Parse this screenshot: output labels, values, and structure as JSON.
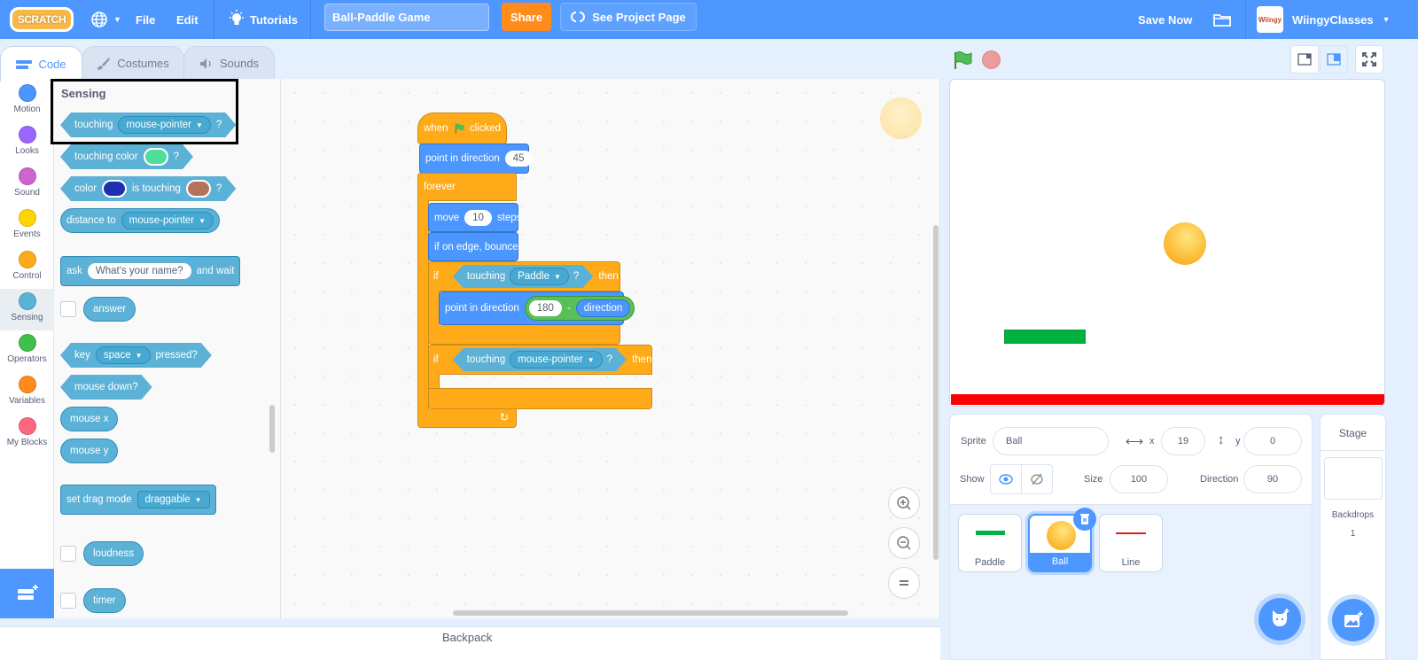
{
  "menubar": {
    "logo": "SCRATCH",
    "language_icon": "globe-icon",
    "file": "File",
    "edit": "Edit",
    "tutorials": "Tutorials",
    "project_title": "Ball-Paddle Game",
    "share": "Share",
    "see_project_page": "See Project Page",
    "save_now": "Save Now",
    "username": "WiingyClasses",
    "avatar_text": "Wiingy"
  },
  "tabs": [
    {
      "label": "Code",
      "icon": "code-icon",
      "active": true
    },
    {
      "label": "Costumes",
      "icon": "brush-icon",
      "active": false
    },
    {
      "label": "Sounds",
      "icon": "speaker-icon",
      "active": false
    }
  ],
  "categories": [
    {
      "label": "Motion",
      "color": "#4c97ff"
    },
    {
      "label": "Looks",
      "color": "#9966ff"
    },
    {
      "label": "Sound",
      "color": "#cf63cf"
    },
    {
      "label": "Events",
      "color": "#ffd500"
    },
    {
      "label": "Control",
      "color": "#ffab19"
    },
    {
      "label": "Sensing",
      "color": "#5cb1d6",
      "selected": true
    },
    {
      "label": "Operators",
      "color": "#40bf4a"
    },
    {
      "label": "Variables",
      "color": "#ff8c1a"
    },
    {
      "label": "My Blocks",
      "color": "#ff6680"
    }
  ],
  "palette": {
    "title": "Sensing",
    "touching": {
      "text": "touching",
      "menu": "mouse-pointer",
      "q": "?"
    },
    "touching_color": {
      "text": "touching color",
      "q": "?",
      "color": "#4cde9a"
    },
    "color_touching": {
      "text1": "color",
      "text2": "is touching",
      "q": "?",
      "color1": "#1f2fb0",
      "color2": "#b5715a"
    },
    "distance_to": {
      "text": "distance to",
      "menu": "mouse-pointer"
    },
    "ask": {
      "text1": "ask",
      "input": "What's your name?",
      "text2": "and wait"
    },
    "answer": "answer",
    "key_pressed": {
      "text1": "key",
      "menu": "space",
      "text2": "pressed?"
    },
    "mouse_down": "mouse down?",
    "mouse_x": "mouse x",
    "mouse_y": "mouse y",
    "set_drag_mode": {
      "text": "set drag mode",
      "menu": "draggable"
    },
    "loudness": "loudness",
    "timer": "timer"
  },
  "script": {
    "when_flag": {
      "text1": "when",
      "text2": "clicked"
    },
    "point_dir_1": {
      "text": "point in direction",
      "value": "45"
    },
    "forever": "forever",
    "move": {
      "text1": "move",
      "value": "10",
      "text2": "steps"
    },
    "bounce": "if on edge, bounce",
    "if1": {
      "if": "if",
      "touching": "touching",
      "menu": "Paddle",
      "q": "?",
      "then": "then"
    },
    "point_dir_2": {
      "text": "point in direction",
      "value": "180",
      "op": "-",
      "reporter": "direction"
    },
    "if2": {
      "if": "if",
      "touching": "touching",
      "menu": "mouse-pointer",
      "q": "?",
      "then": "then"
    }
  },
  "backpack": "Backpack",
  "sprite_info": {
    "sprite_label": "Sprite",
    "sprite_name": "Ball",
    "x_label": "x",
    "x_value": "19",
    "y_label": "y",
    "y_value": "0",
    "show_label": "Show",
    "size_label": "Size",
    "size_value": "100",
    "direction_label": "Direction",
    "direction_value": "90"
  },
  "sprites": [
    {
      "name": "Paddle",
      "selected": false
    },
    {
      "name": "Ball",
      "selected": true
    },
    {
      "name": "Line",
      "selected": false
    }
  ],
  "stage_panel": {
    "title": "Stage",
    "backdrops_label": "Backdrops",
    "backdrops_count": "1"
  },
  "colors": {
    "accent": "#4d97ff",
    "share": "#ff8c1a",
    "sensing": "#5cb1d6",
    "control": "#ffab19",
    "motion": "#4c97ff",
    "operators": "#59c059",
    "stage_line": "#ff0000",
    "paddle": "#00b140"
  }
}
